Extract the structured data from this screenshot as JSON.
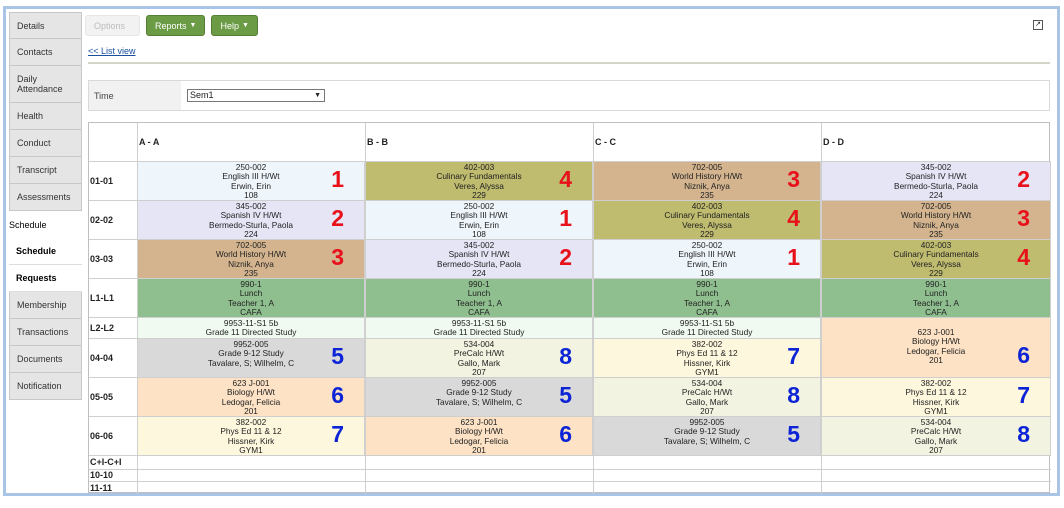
{
  "sidebar": {
    "items": [
      {
        "label": "Details"
      },
      {
        "label": "Contacts"
      },
      {
        "label": "Daily Attendance"
      },
      {
        "label": "Health"
      },
      {
        "label": "Conduct"
      },
      {
        "label": "Transcript"
      },
      {
        "label": "Assessments"
      },
      {
        "label": "Schedule"
      },
      {
        "label": "Schedule"
      },
      {
        "label": "Requests"
      },
      {
        "label": "Membership"
      },
      {
        "label": "Transactions"
      },
      {
        "label": "Documents"
      },
      {
        "label": "Notification"
      }
    ]
  },
  "toolbar": {
    "options_label": "Options",
    "reports_label": "Reports",
    "help_label": "Help",
    "list_view_label": "<< List view"
  },
  "filter": {
    "time_label": "Time",
    "time_value": "Sem1"
  },
  "matrix": {
    "columns": [
      "A - A",
      "B - B",
      "C - C",
      "D - D"
    ],
    "rows": [
      "01-01",
      "02-02",
      "03-03",
      "L1-L1",
      "L2-L2",
      "04-04",
      "05-05",
      "06-06",
      "C+I-C+I",
      "10-10",
      "11-11"
    ],
    "colors": {
      "english": "#eef5fb",
      "spanish": "#e5e5f6",
      "culinary": "#bfbb6f",
      "history": "#d3b48f",
      "lunch": "#8fbf8f",
      "directed": "#f0faf0",
      "study": "#d9d9d9",
      "biology": "#fde2c5",
      "precalc": "#f3f3e1",
      "phys": "#fdf7dd",
      "red_num": "#e8101a",
      "blue_num": "#0c24d6"
    },
    "cells": {
      "r01a": {
        "lines": [
          "250-002",
          "English III H/Wt",
          "Erwin, Erin",
          "108"
        ],
        "num": "1"
      },
      "r01b": {
        "lines": [
          "402-003",
          "Culinary Fundamentals",
          "Veres, Alyssa",
          "229"
        ],
        "num": "4"
      },
      "r01c": {
        "lines": [
          "702-005",
          "World History H/Wt",
          "Niznik, Anya",
          "235"
        ],
        "num": "3"
      },
      "r01d": {
        "lines": [
          "345-002",
          "Spanish IV H/Wt",
          "Bermedo-Sturla, Paola",
          "224"
        ],
        "num": "2"
      },
      "r02a": {
        "lines": [
          "345-002",
          "Spanish IV H/Wt",
          "Bermedo-Sturla, Paola",
          "224"
        ],
        "num": "2"
      },
      "r02b": {
        "lines": [
          "250-002",
          "English III H/Wt",
          "Erwin, Erin",
          "108"
        ],
        "num": "1"
      },
      "r02c": {
        "lines": [
          "402-003",
          "Culinary Fundamentals",
          "Veres, Alyssa",
          "229"
        ],
        "num": "4"
      },
      "r02d": {
        "lines": [
          "702-005",
          "World History H/Wt",
          "Niznik, Anya",
          "235"
        ],
        "num": "3"
      },
      "r03a": {
        "lines": [
          "702-005",
          "World History H/Wt",
          "Niznik, Anya",
          "235"
        ],
        "num": "3"
      },
      "r03b": {
        "lines": [
          "345-002",
          "Spanish IV H/Wt",
          "Bermedo-Sturla, Paola",
          "224"
        ],
        "num": "2"
      },
      "r03c": {
        "lines": [
          "250-002",
          "English III H/Wt",
          "Erwin, Erin",
          "108"
        ],
        "num": "1"
      },
      "r03d": {
        "lines": [
          "402-003",
          "Culinary Fundamentals",
          "Veres, Alyssa",
          "229"
        ],
        "num": "4"
      },
      "rL1a": {
        "lines": [
          "990-1",
          "Lunch",
          "Teacher 1, A",
          "CAFA"
        ]
      },
      "rL1b": {
        "lines": [
          "990-1",
          "Lunch",
          "Teacher 1, A",
          "CAFA"
        ]
      },
      "rL1c": {
        "lines": [
          "990-1",
          "Lunch",
          "Teacher 1, A",
          "CAFA"
        ]
      },
      "rL1d": {
        "lines": [
          "990-1",
          "Lunch",
          "Teacher 1, A",
          "CAFA"
        ]
      },
      "rL2a": {
        "lines": [
          "9953-11-S1 5b",
          "Grade 11 Directed Study"
        ]
      },
      "rL2b": {
        "lines": [
          "9953-11-S1 5b",
          "Grade 11 Directed Study"
        ]
      },
      "rL2c": {
        "lines": [
          "9953-11-S1 5b",
          "Grade 11 Directed Study"
        ]
      },
      "r04a": {
        "lines": [
          "9952-005",
          "Grade 9-12 Study",
          "Tavalare, S; Wilhelm, C"
        ],
        "num": "5"
      },
      "r04b": {
        "lines": [
          "534-004",
          "PreCalc H/Wt",
          "Gallo, Mark",
          "207"
        ],
        "num": "8"
      },
      "r04c": {
        "lines": [
          "382-002",
          "Phys Ed 11 & 12",
          "Hissner, Kirk",
          "GYM1"
        ],
        "num": "7"
      },
      "r04d": {
        "lines": [
          "623 J-001",
          "Biology H/Wt",
          "Ledogar, Felicia",
          "201"
        ],
        "num": "6"
      },
      "r05a": {
        "lines": [
          "623 J-001",
          "Biology H/Wt",
          "Ledogar, Felicia",
          "201"
        ],
        "num": "6"
      },
      "r05b": {
        "lines": [
          "9952-005",
          "Grade 9-12 Study",
          "Tavalare, S; Wilhelm, C"
        ],
        "num": "5"
      },
      "r05c": {
        "lines": [
          "534-004",
          "PreCalc H/Wt",
          "Gallo, Mark",
          "207"
        ],
        "num": "8"
      },
      "r05d": {
        "lines": [
          "382-002",
          "Phys Ed 11 & 12",
          "Hissner, Kirk",
          "GYM1"
        ],
        "num": "7"
      },
      "r06a": {
        "lines": [
          "382-002",
          "Phys Ed 11 & 12",
          "Hissner, Kirk",
          "GYM1"
        ],
        "num": "7"
      },
      "r06b": {
        "lines": [
          "623 J-001",
          "Biology H/Wt",
          "Ledogar, Felicia",
          "201"
        ],
        "num": "6"
      },
      "r06c": {
        "lines": [
          "9952-005",
          "Grade 9-12 Study",
          "Tavalare, S; Wilhelm, C"
        ],
        "num": "5"
      },
      "r06d": {
        "lines": [
          "534-004",
          "PreCalc H/Wt",
          "Gallo, Mark",
          "207"
        ],
        "num": "8"
      }
    }
  }
}
